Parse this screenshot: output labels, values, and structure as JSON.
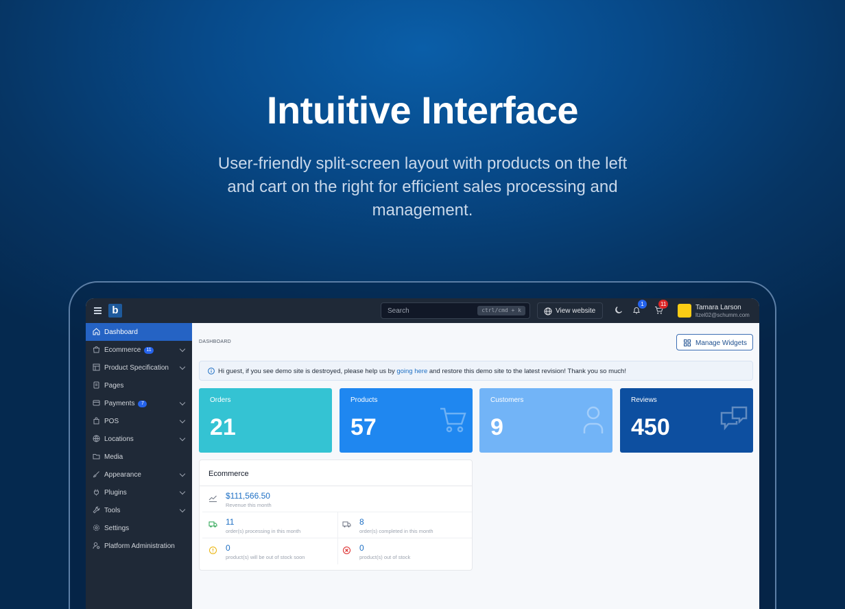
{
  "hero": {
    "title": "Intuitive Interface",
    "subtitle": "User-friendly split-screen layout  with products on the left\nand cart on the right for efficient sales  processing and\nmanagement."
  },
  "topbar": {
    "logo_letter": "b",
    "search_placeholder": "Search",
    "search_shortcut": "ctrl/cmd + k",
    "view_website": "View website",
    "notifications_count": "1",
    "cart_count": "11",
    "user_name": "Tamara Larson",
    "user_email": "ltzel02@schumm.com"
  },
  "sidebar": {
    "items": [
      {
        "label": "Dashboard",
        "active": true
      },
      {
        "label": "Ecommerce",
        "badge": "11",
        "chevron": true
      },
      {
        "label": "Product Specification",
        "chevron": true
      },
      {
        "label": "Pages"
      },
      {
        "label": "Payments",
        "badge": "7",
        "chevron": true
      },
      {
        "label": "POS",
        "chevron": true
      },
      {
        "label": "Locations",
        "chevron": true
      },
      {
        "label": "Media"
      },
      {
        "label": "Appearance",
        "chevron": true
      },
      {
        "label": "Plugins",
        "chevron": true
      },
      {
        "label": "Tools",
        "chevron": true
      },
      {
        "label": "Settings"
      },
      {
        "label": "Platform Administration"
      }
    ]
  },
  "main": {
    "breadcrumb": "DASHBOARD",
    "manage_widgets": "Manage Widgets",
    "alert": {
      "before": "Hi guest, if you see demo site is destroyed, please help us by ",
      "link": "going here",
      "after": " and restore this demo site to the latest revision! Thank you so much!"
    },
    "stats": [
      {
        "label": "Orders",
        "value": "21",
        "color": "#34c3d3"
      },
      {
        "label": "Products",
        "value": "57",
        "color": "#1f87f0"
      },
      {
        "label": "Customers",
        "value": "9",
        "color": "#72b4f7"
      },
      {
        "label": "Reviews",
        "value": "450",
        "color": "#0d4fa0"
      }
    ],
    "ecommerce": {
      "title": "Ecommerce",
      "revenue_value": "$111,566.50",
      "revenue_desc": "Revenue this month",
      "processing_value": "11",
      "processing_desc": "order(s) processing in this month",
      "completed_value": "8",
      "completed_desc": "order(s) completed in this month",
      "out_soon_value": "0",
      "out_soon_desc": "product(s) will be out of stock soon",
      "out_value": "0",
      "out_desc": "product(s) out of stock"
    }
  },
  "colors": {
    "sidebar_bg": "#1f2937",
    "accent": "#2563c4",
    "link": "#1d6fc4"
  }
}
